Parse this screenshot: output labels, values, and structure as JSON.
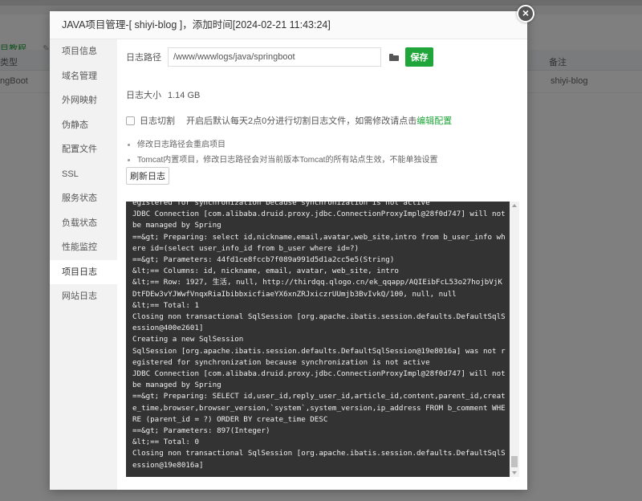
{
  "background": {
    "tab_tutorial": "目教程",
    "tab_icon": "edit-icon",
    "table_header": {
      "type": "类型",
      "remark": "备注"
    },
    "table_row": {
      "type": "ngBoot",
      "remark": "shiyi-blog"
    }
  },
  "modal": {
    "title": "JAVA项目管理-[ shiyi-blog ]，添加时间[2024-02-21 11:43:24]",
    "close_symbol": "×",
    "sidebar": [
      {
        "label": "项目信息"
      },
      {
        "label": "域名管理"
      },
      {
        "label": "外网映射"
      },
      {
        "label": "伪静态"
      },
      {
        "label": "配置文件"
      },
      {
        "label": "SSL"
      },
      {
        "label": "服务状态"
      },
      {
        "label": "负载状态"
      },
      {
        "label": "性能监控"
      },
      {
        "label": "项目日志",
        "active": true
      },
      {
        "label": "网站日志"
      }
    ],
    "log_path_label": "日志路径",
    "log_path_value": "/www/wwwlogs/java/springboot",
    "folder_icon": "folder-icon",
    "save_label": "保存",
    "log_size_label": "日志大小",
    "log_size_value": "1.14 GB",
    "log_cut_label": "日志切割",
    "log_cut_desc": "开启后默认每天2点0分进行切割日志文件，如需修改请点击",
    "edit_config_link": "编辑配置",
    "tips": [
      "修改日志路径会重启项目",
      "Tomcat内置项目，修改日志路径会对当前版本Tomcat的所有站点生效，不能单独设置"
    ],
    "refresh_label": "刷新日志",
    "log_content": "egistered for synchronization because synchronization is not active\nJDBC Connection [com.alibaba.druid.proxy.jdbc.ConnectionProxyImpl@28f0d747] will not be managed by Spring\n==&gt; Preparing: select id,nickname,email,avatar,web_site,intro from b_user_info where id=(select user_info_id from b_user where id=?)\n==&gt; Parameters: 44fd1ce8fccb7f089a991d5d1a2cc5e5(String)\n&lt;== Columns: id, nickname, email, avatar, web_site, intro\n&lt;== Row: 1927, 生活, null, http://thirdqq.qlogo.cn/ek_qqapp/AQIEibFcL53o27hojbVjKDtFDEw3vYJWwfVnqxRiaIbibbxicfiaeYX6xnZRJxiczrUUmjb3BvIvkQ/100, null, null\n&lt;== Total: 1\nClosing non transactional SqlSession [org.apache.ibatis.session.defaults.DefaultSqlSession@400e2601]\nCreating a new SqlSession\nSqlSession [org.apache.ibatis.session.defaults.DefaultSqlSession@19e8016a] was not registered for synchronization because synchronization is not active\nJDBC Connection [com.alibaba.druid.proxy.jdbc.ConnectionProxyImpl@28f0d747] will not be managed by Spring\n==&gt; Preparing: SELECT id,user_id,reply_user_id,article_id,content,parent_id,create_time,browser,browser_version,`system`,system_version,ip_address FROM b_comment WHERE (parent_id = ?) ORDER BY create_time DESC\n==&gt; Parameters: 897(Integer)\n&lt;== Total: 0\nClosing non transactional SqlSession [org.apache.ibatis.session.defaults.DefaultSqlSession@19e8016a]"
  }
}
